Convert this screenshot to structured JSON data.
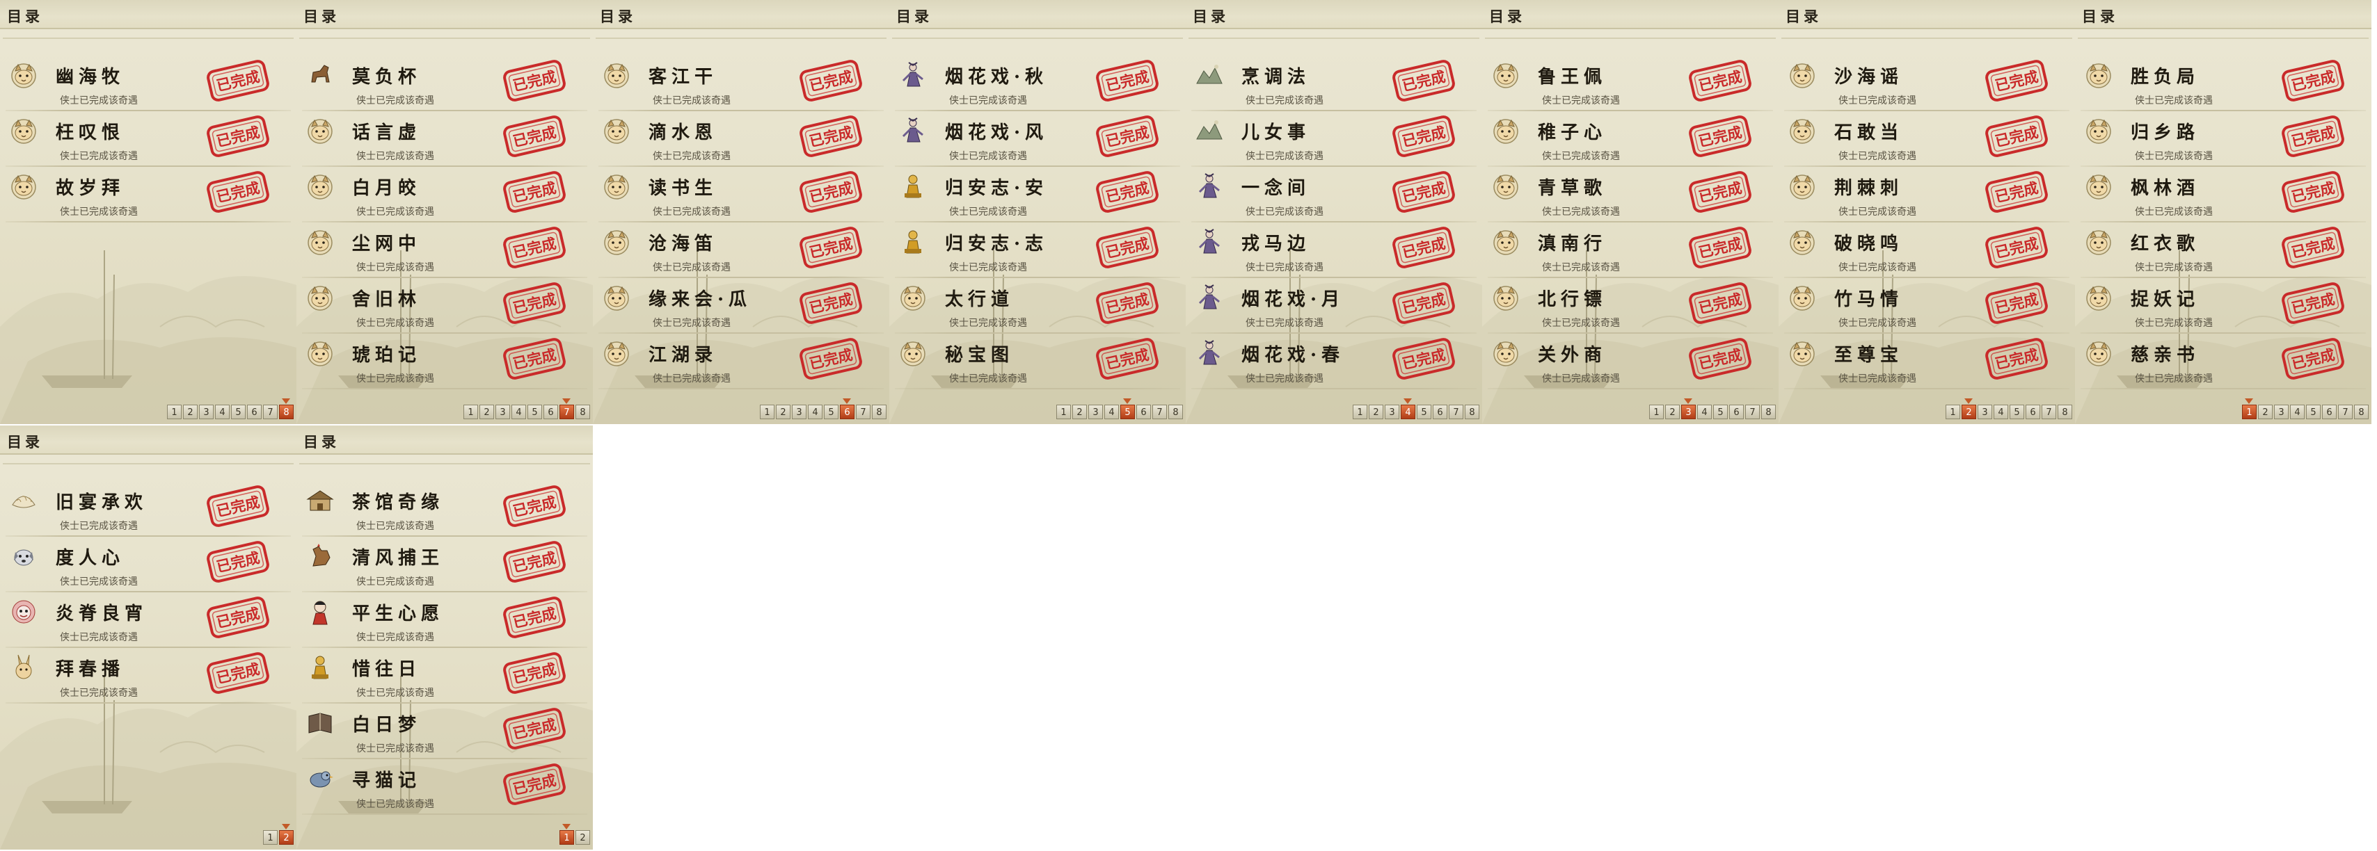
{
  "header_title": "目录",
  "row_desc": "侠士已完成该奇遇",
  "stamp_label": "已完成",
  "colors": {
    "accent": "#c01f1f",
    "active_page": "#c64a1f"
  },
  "panels": [
    {
      "items": [
        {
          "name": "幽海牧",
          "icon": "cat-icon"
        },
        {
          "name": "枉叹恨",
          "icon": "cat-icon"
        },
        {
          "name": "故岁拜",
          "icon": "cat-icon"
        }
      ],
      "pages": [
        "1",
        "2",
        "3",
        "4",
        "5",
        "6",
        "7",
        "8"
      ],
      "active": 8
    },
    {
      "items": [
        {
          "name": "莫负杯",
          "icon": "horse-icon"
        },
        {
          "name": "话言虚",
          "icon": "cat-icon"
        },
        {
          "name": "白月皎",
          "icon": "cat-icon"
        },
        {
          "name": "尘网中",
          "icon": "cat-icon"
        },
        {
          "name": "舍旧林",
          "icon": "cat-icon"
        },
        {
          "name": "琥珀记",
          "icon": "cat-icon"
        }
      ],
      "pages": [
        "1",
        "2",
        "3",
        "4",
        "5",
        "6",
        "7",
        "8"
      ],
      "active": 7
    },
    {
      "items": [
        {
          "name": "客江干",
          "icon": "cat-icon"
        },
        {
          "name": "滴水恩",
          "icon": "cat-icon"
        },
        {
          "name": "读书生",
          "icon": "cat-icon"
        },
        {
          "name": "沧海笛",
          "icon": "cat-icon"
        },
        {
          "name": "缘来会·瓜",
          "icon": "cat-icon"
        },
        {
          "name": "江湖录",
          "icon": "cat-icon"
        }
      ],
      "pages": [
        "1",
        "2",
        "3",
        "4",
        "5",
        "6",
        "7",
        "8"
      ],
      "active": 6
    },
    {
      "items": [
        {
          "name": "烟花戏·秋",
          "icon": "figure-icon"
        },
        {
          "name": "烟花戏·风",
          "icon": "figure-icon"
        },
        {
          "name": "归安志·安",
          "icon": "gold-figure-icon"
        },
        {
          "name": "归安志·志",
          "icon": "gold-figure-icon"
        },
        {
          "name": "太行道",
          "icon": "cat-icon"
        },
        {
          "name": "秘宝图",
          "icon": "cat-icon"
        }
      ],
      "pages": [
        "1",
        "2",
        "3",
        "4",
        "5",
        "6",
        "7",
        "8"
      ],
      "active": 5
    },
    {
      "items": [
        {
          "name": "烹调法",
          "icon": "landscape-icon"
        },
        {
          "name": "儿女事",
          "icon": "landscape-icon"
        },
        {
          "name": "一念间",
          "icon": "figure-icon"
        },
        {
          "name": "戎马边",
          "icon": "figure-icon"
        },
        {
          "name": "烟花戏·月",
          "icon": "figure-icon"
        },
        {
          "name": "烟花戏·春",
          "icon": "figure-icon"
        }
      ],
      "pages": [
        "1",
        "2",
        "3",
        "4",
        "5",
        "6",
        "7",
        "8"
      ],
      "active": 4
    },
    {
      "items": [
        {
          "name": "鲁王佩",
          "icon": "cat-icon"
        },
        {
          "name": "稚子心",
          "icon": "cat-icon"
        },
        {
          "name": "青草歌",
          "icon": "cat-icon"
        },
        {
          "name": "滇南行",
          "icon": "cat-icon"
        },
        {
          "name": "北行镖",
          "icon": "cat-icon"
        },
        {
          "name": "关外商",
          "icon": "cat-icon"
        }
      ],
      "pages": [
        "1",
        "2",
        "3",
        "4",
        "5",
        "6",
        "7",
        "8"
      ],
      "active": 3
    },
    {
      "items": [
        {
          "name": "沙海谣",
          "icon": "cat-icon"
        },
        {
          "name": "石敢当",
          "icon": "cat-icon"
        },
        {
          "name": "荆棘刺",
          "icon": "cat-icon"
        },
        {
          "name": "破晓鸣",
          "icon": "cat-icon"
        },
        {
          "name": "竹马情",
          "icon": "cat-icon"
        },
        {
          "name": "至尊宝",
          "icon": "cat-icon"
        }
      ],
      "pages": [
        "1",
        "2",
        "3",
        "4",
        "5",
        "6",
        "7",
        "8"
      ],
      "active": 2
    },
    {
      "items": [
        {
          "name": "胜负局",
          "icon": "cat-icon"
        },
        {
          "name": "归乡路",
          "icon": "cat-icon"
        },
        {
          "name": "枫林酒",
          "icon": "cat-icon"
        },
        {
          "name": "红衣歌",
          "icon": "cat-icon"
        },
        {
          "name": "捉妖记",
          "icon": "cat-icon"
        },
        {
          "name": "慈亲书",
          "icon": "cat-icon"
        }
      ],
      "pages": [
        "1",
        "2",
        "3",
        "4",
        "5",
        "6",
        "7",
        "8"
      ],
      "active": 1
    },
    {
      "items": [
        {
          "name": "旧宴承欢",
          "icon": "dumpling-icon"
        },
        {
          "name": "度人心",
          "icon": "dog-icon"
        },
        {
          "name": "炎脊良宵",
          "icon": "lion-icon"
        },
        {
          "name": "拜春播",
          "icon": "rabbit-icon"
        }
      ],
      "pages": [
        "1",
        "2"
      ],
      "active": 2
    },
    {
      "items": [
        {
          "name": "茶馆奇缘",
          "icon": "teahouse-icon"
        },
        {
          "name": "清风捕王",
          "icon": "rooster-icon"
        },
        {
          "name": "平生心愿",
          "icon": "child-icon"
        },
        {
          "name": "惜往日",
          "icon": "gold-figure-icon"
        },
        {
          "name": "白日梦",
          "icon": "book-icon"
        },
        {
          "name": "寻猫记",
          "icon": "bird-icon"
        }
      ],
      "pages": [
        "1",
        "2"
      ],
      "active": 1
    }
  ]
}
